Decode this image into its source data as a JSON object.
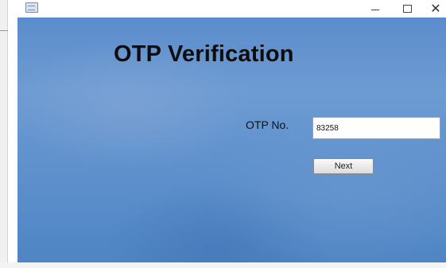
{
  "window": {
    "icon": "app-window-icon",
    "controls": {
      "minimize_icon": "minimize-icon",
      "maximize_icon": "maximize-icon",
      "close_glyph": "✕"
    }
  },
  "form": {
    "title": "OTP Verification",
    "otp_label": "OTP No.",
    "otp_value": "83258",
    "next_label": "Next"
  },
  "colors": {
    "background_top": "#5b8ccb",
    "background_bottom": "#4f85c4",
    "title_text": "#0d0d0d"
  }
}
